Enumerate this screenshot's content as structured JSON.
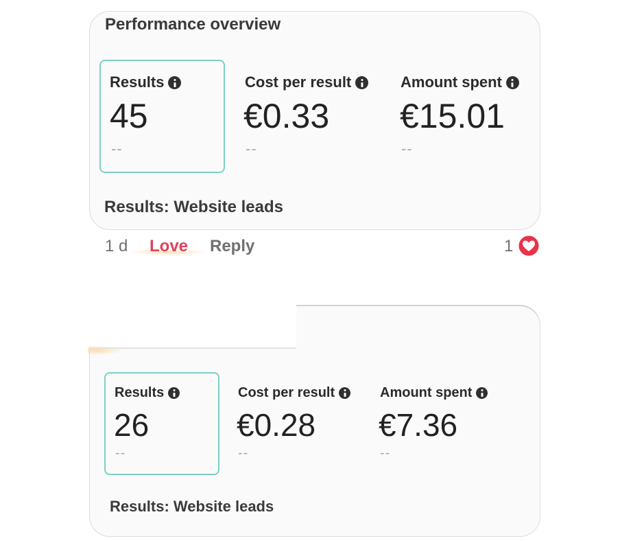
{
  "top_card": {
    "title": "Performance overview",
    "metrics": [
      {
        "label": "Results",
        "value": "45",
        "comparison": "--"
      },
      {
        "label": "Cost per result",
        "value": "€0.33",
        "comparison": "--"
      },
      {
        "label": "Amount spent",
        "value": "€15.01",
        "comparison": "--"
      }
    ],
    "footer": "Results: Website leads"
  },
  "comment_actions": {
    "time": "1 d",
    "love": "Love",
    "reply": "Reply",
    "reaction_count": "1"
  },
  "bottom_card": {
    "metrics": [
      {
        "label": "Results",
        "value": "26",
        "comparison": "--"
      },
      {
        "label": "Cost per result",
        "value": "€0.28",
        "comparison": "--"
      },
      {
        "label": "Amount spent",
        "value": "€7.36",
        "comparison": "--"
      }
    ],
    "footer": "Results: Website leads"
  },
  "colors": {
    "love_active": "#e0415e",
    "heart_reaction": "#e8334a",
    "selected_border": "#7cd0c4"
  },
  "icons": [
    "info-icon",
    "heart-reaction-icon"
  ]
}
